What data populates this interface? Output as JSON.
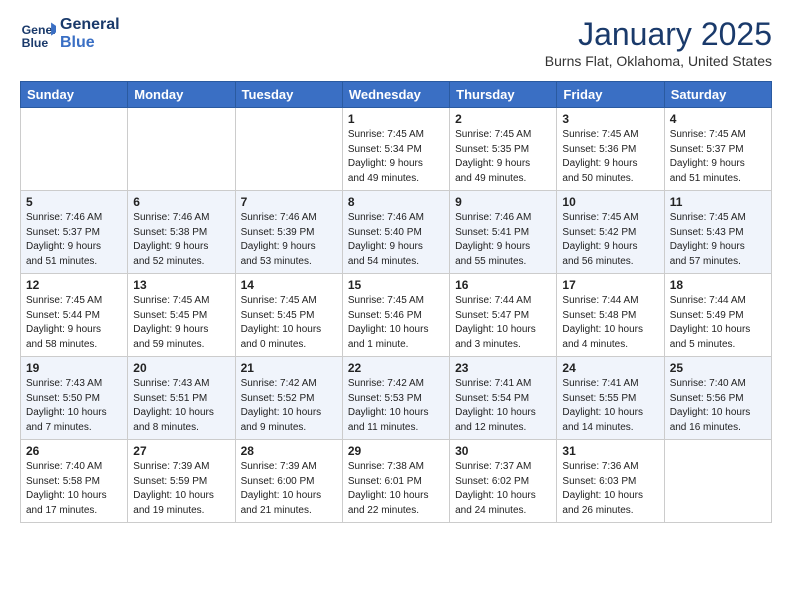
{
  "header": {
    "logo_line1": "General",
    "logo_line2": "Blue",
    "month": "January 2025",
    "location": "Burns Flat, Oklahoma, United States"
  },
  "weekdays": [
    "Sunday",
    "Monday",
    "Tuesday",
    "Wednesday",
    "Thursday",
    "Friday",
    "Saturday"
  ],
  "rows": [
    [
      {
        "day": "",
        "info": ""
      },
      {
        "day": "",
        "info": ""
      },
      {
        "day": "",
        "info": ""
      },
      {
        "day": "1",
        "info": "Sunrise: 7:45 AM\nSunset: 5:34 PM\nDaylight: 9 hours\nand 49 minutes."
      },
      {
        "day": "2",
        "info": "Sunrise: 7:45 AM\nSunset: 5:35 PM\nDaylight: 9 hours\nand 49 minutes."
      },
      {
        "day": "3",
        "info": "Sunrise: 7:45 AM\nSunset: 5:36 PM\nDaylight: 9 hours\nand 50 minutes."
      },
      {
        "day": "4",
        "info": "Sunrise: 7:45 AM\nSunset: 5:37 PM\nDaylight: 9 hours\nand 51 minutes."
      }
    ],
    [
      {
        "day": "5",
        "info": "Sunrise: 7:46 AM\nSunset: 5:37 PM\nDaylight: 9 hours\nand 51 minutes."
      },
      {
        "day": "6",
        "info": "Sunrise: 7:46 AM\nSunset: 5:38 PM\nDaylight: 9 hours\nand 52 minutes."
      },
      {
        "day": "7",
        "info": "Sunrise: 7:46 AM\nSunset: 5:39 PM\nDaylight: 9 hours\nand 53 minutes."
      },
      {
        "day": "8",
        "info": "Sunrise: 7:46 AM\nSunset: 5:40 PM\nDaylight: 9 hours\nand 54 minutes."
      },
      {
        "day": "9",
        "info": "Sunrise: 7:46 AM\nSunset: 5:41 PM\nDaylight: 9 hours\nand 55 minutes."
      },
      {
        "day": "10",
        "info": "Sunrise: 7:45 AM\nSunset: 5:42 PM\nDaylight: 9 hours\nand 56 minutes."
      },
      {
        "day": "11",
        "info": "Sunrise: 7:45 AM\nSunset: 5:43 PM\nDaylight: 9 hours\nand 57 minutes."
      }
    ],
    [
      {
        "day": "12",
        "info": "Sunrise: 7:45 AM\nSunset: 5:44 PM\nDaylight: 9 hours\nand 58 minutes."
      },
      {
        "day": "13",
        "info": "Sunrise: 7:45 AM\nSunset: 5:45 PM\nDaylight: 9 hours\nand 59 minutes."
      },
      {
        "day": "14",
        "info": "Sunrise: 7:45 AM\nSunset: 5:45 PM\nDaylight: 10 hours\nand 0 minutes."
      },
      {
        "day": "15",
        "info": "Sunrise: 7:45 AM\nSunset: 5:46 PM\nDaylight: 10 hours\nand 1 minute."
      },
      {
        "day": "16",
        "info": "Sunrise: 7:44 AM\nSunset: 5:47 PM\nDaylight: 10 hours\nand 3 minutes."
      },
      {
        "day": "17",
        "info": "Sunrise: 7:44 AM\nSunset: 5:48 PM\nDaylight: 10 hours\nand 4 minutes."
      },
      {
        "day": "18",
        "info": "Sunrise: 7:44 AM\nSunset: 5:49 PM\nDaylight: 10 hours\nand 5 minutes."
      }
    ],
    [
      {
        "day": "19",
        "info": "Sunrise: 7:43 AM\nSunset: 5:50 PM\nDaylight: 10 hours\nand 7 minutes."
      },
      {
        "day": "20",
        "info": "Sunrise: 7:43 AM\nSunset: 5:51 PM\nDaylight: 10 hours\nand 8 minutes."
      },
      {
        "day": "21",
        "info": "Sunrise: 7:42 AM\nSunset: 5:52 PM\nDaylight: 10 hours\nand 9 minutes."
      },
      {
        "day": "22",
        "info": "Sunrise: 7:42 AM\nSunset: 5:53 PM\nDaylight: 10 hours\nand 11 minutes."
      },
      {
        "day": "23",
        "info": "Sunrise: 7:41 AM\nSunset: 5:54 PM\nDaylight: 10 hours\nand 12 minutes."
      },
      {
        "day": "24",
        "info": "Sunrise: 7:41 AM\nSunset: 5:55 PM\nDaylight: 10 hours\nand 14 minutes."
      },
      {
        "day": "25",
        "info": "Sunrise: 7:40 AM\nSunset: 5:56 PM\nDaylight: 10 hours\nand 16 minutes."
      }
    ],
    [
      {
        "day": "26",
        "info": "Sunrise: 7:40 AM\nSunset: 5:58 PM\nDaylight: 10 hours\nand 17 minutes."
      },
      {
        "day": "27",
        "info": "Sunrise: 7:39 AM\nSunset: 5:59 PM\nDaylight: 10 hours\nand 19 minutes."
      },
      {
        "day": "28",
        "info": "Sunrise: 7:39 AM\nSunset: 6:00 PM\nDaylight: 10 hours\nand 21 minutes."
      },
      {
        "day": "29",
        "info": "Sunrise: 7:38 AM\nSunset: 6:01 PM\nDaylight: 10 hours\nand 22 minutes."
      },
      {
        "day": "30",
        "info": "Sunrise: 7:37 AM\nSunset: 6:02 PM\nDaylight: 10 hours\nand 24 minutes."
      },
      {
        "day": "31",
        "info": "Sunrise: 7:36 AM\nSunset: 6:03 PM\nDaylight: 10 hours\nand 26 minutes."
      },
      {
        "day": "",
        "info": ""
      }
    ]
  ]
}
